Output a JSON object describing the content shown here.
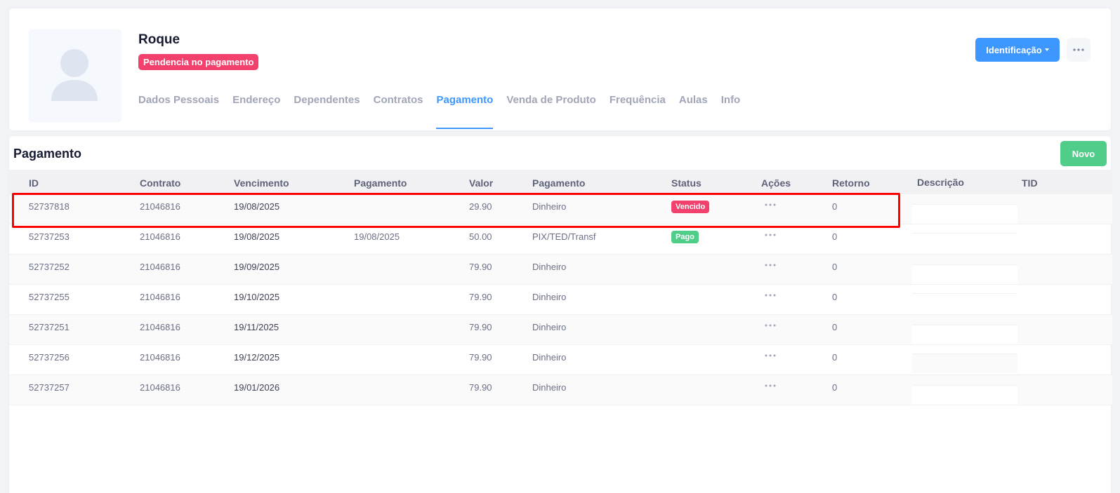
{
  "profile": {
    "name": "Roque",
    "badge": "Pendencia no pagamento",
    "tabs": [
      {
        "label": "Dados Pessoais",
        "active": false
      },
      {
        "label": "Endereço",
        "active": false
      },
      {
        "label": "Dependentes",
        "active": false
      },
      {
        "label": "Contratos",
        "active": false
      },
      {
        "label": "Pagamento",
        "active": true
      },
      {
        "label": "Venda de Produto",
        "active": false
      },
      {
        "label": "Frequência",
        "active": false
      },
      {
        "label": "Aulas",
        "active": false
      },
      {
        "label": "Info",
        "active": false
      }
    ],
    "identification_button": "Identificação",
    "more_icon": "more-horizontal-icon"
  },
  "payments": {
    "title": "Pagamento",
    "new_button": "Novo",
    "columns": [
      "ID",
      "Contrato",
      "Vencimento",
      "Pagamento",
      "Valor",
      "Pagamento",
      "Status",
      "Ações",
      "Retorno",
      "Descrição",
      "TID"
    ],
    "rows": [
      {
        "id": "52737818",
        "contrato": "21046816",
        "vencimento": "19/08/2025",
        "pagamento_data": "",
        "valor": "29.90",
        "metodo": "Dinheiro",
        "status": "Vencido",
        "retorno": "0",
        "descricao": "",
        "tid": ""
      },
      {
        "id": "52737253",
        "contrato": "21046816",
        "vencimento": "19/08/2025",
        "pagamento_data": "19/08/2025",
        "valor": "50.00",
        "metodo": "PIX/TED/Transf",
        "status": "Pago",
        "retorno": "0",
        "descricao": "",
        "tid": ""
      },
      {
        "id": "52737252",
        "contrato": "21046816",
        "vencimento": "19/09/2025",
        "pagamento_data": "",
        "valor": "79.90",
        "metodo": "Dinheiro",
        "status": "",
        "retorno": "0",
        "descricao": "",
        "tid": ""
      },
      {
        "id": "52737255",
        "contrato": "21046816",
        "vencimento": "19/10/2025",
        "pagamento_data": "",
        "valor": "79.90",
        "metodo": "Dinheiro",
        "status": "",
        "retorno": "0",
        "descricao": "",
        "tid": ""
      },
      {
        "id": "52737251",
        "contrato": "21046816",
        "vencimento": "19/11/2025",
        "pagamento_data": "",
        "valor": "79.90",
        "metodo": "Dinheiro",
        "status": "",
        "retorno": "0",
        "descricao": "",
        "tid": ""
      },
      {
        "id": "52737256",
        "contrato": "21046816",
        "vencimento": "19/12/2025",
        "pagamento_data": "",
        "valor": "79.90",
        "metodo": "Dinheiro",
        "status": "",
        "retorno": "0",
        "descricao": "",
        "tid": ""
      },
      {
        "id": "52737257",
        "contrato": "21046816",
        "vencimento": "19/01/2026",
        "pagamento_data": "",
        "valor": "79.90",
        "metodo": "Dinheiro",
        "status": "",
        "retorno": "0",
        "descricao": "",
        "tid": ""
      }
    ],
    "actions_icon": "more-horizontal-icon"
  },
  "colors": {
    "primary": "#3e97ff",
    "success": "#50cd89",
    "danger": "#f1416c",
    "highlight": "#ff0000"
  }
}
